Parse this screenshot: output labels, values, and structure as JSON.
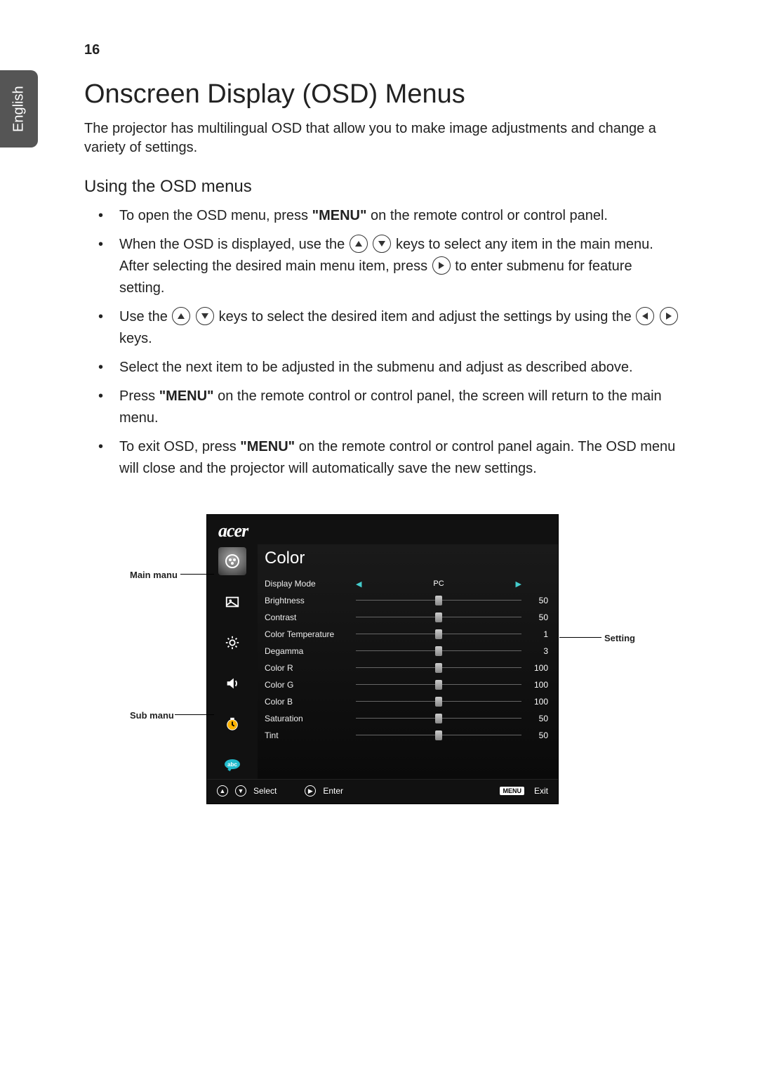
{
  "page_number": "16",
  "language_tab": "English",
  "heading": "Onscreen Display (OSD) Menus",
  "intro": "The projector has multilingual OSD that allow you to make image adjustments and change a variety of settings.",
  "subheading": "Using the OSD menus",
  "bullets": {
    "b1a": "To open the OSD menu, press ",
    "b1b": "\"MENU\"",
    "b1c": " on the remote control or control panel.",
    "b2a": "When the OSD is displayed, use the ",
    "b2b": " keys to select any item in the main menu. After selecting the desired main menu item, press ",
    "b2c": " to enter submenu for feature setting.",
    "b3a": "Use the ",
    "b3b": " keys to select the desired item and adjust the settings by using the ",
    "b3c": " keys.",
    "b4": "Select the next item to be adjusted in the submenu and adjust as described above.",
    "b5a": "Press ",
    "b5b": "\"MENU\"",
    "b5c": " on the remote control or control panel, the screen will return to the main menu.",
    "b6a": "To exit OSD, press ",
    "b6b": "\"MENU\"",
    "b6c": " on the remote control or control panel again. The OSD menu will close and the projector will automatically save the new settings."
  },
  "callouts": {
    "main_menu": "Main manu",
    "sub_menu": "Sub manu",
    "setting": "Setting"
  },
  "osd": {
    "logo": "acer",
    "title": "Color",
    "rows": [
      {
        "label": "Display Mode",
        "type": "select",
        "value": "PC"
      },
      {
        "label": "Brightness",
        "type": "slider",
        "value": "50",
        "pct": 50
      },
      {
        "label": "Contrast",
        "type": "slider",
        "value": "50",
        "pct": 50
      },
      {
        "label": "Color Temperature",
        "type": "slider",
        "value": "1",
        "pct": 50
      },
      {
        "label": "Degamma",
        "type": "slider",
        "value": "3",
        "pct": 50
      },
      {
        "label": "Color R",
        "type": "slider",
        "value": "100",
        "pct": 50
      },
      {
        "label": "Color G",
        "type": "slider",
        "value": "100",
        "pct": 50
      },
      {
        "label": "Color B",
        "type": "slider",
        "value": "100",
        "pct": 50
      },
      {
        "label": "Saturation",
        "type": "slider",
        "value": "50",
        "pct": 50
      },
      {
        "label": "Tint",
        "type": "slider",
        "value": "50",
        "pct": 50
      }
    ],
    "footer": {
      "select": "Select",
      "enter": "Enter",
      "menu_key": "MENU",
      "exit": "Exit"
    }
  }
}
